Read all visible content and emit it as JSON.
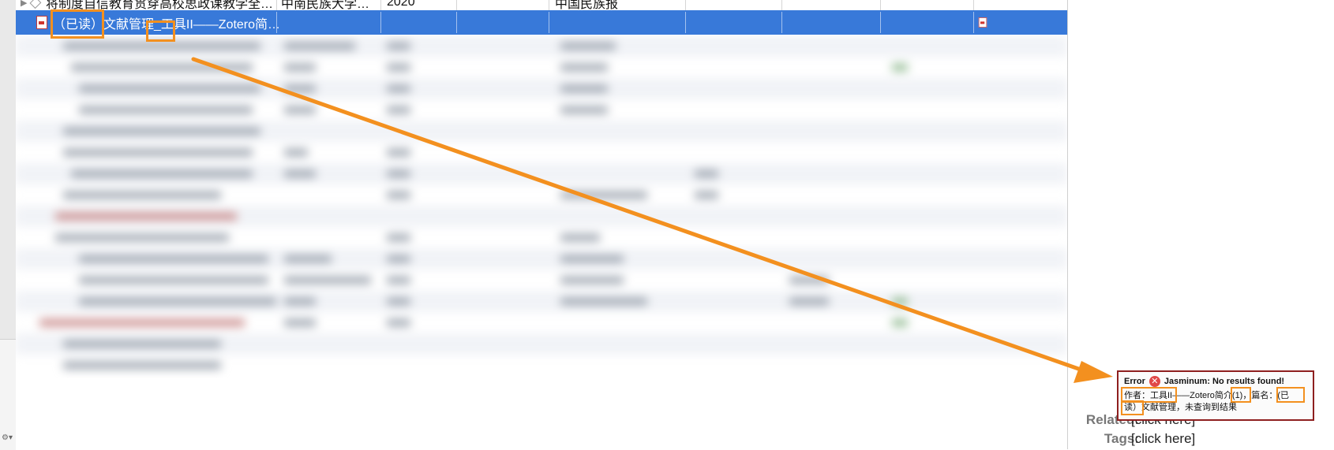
{
  "rows": {
    "previous": {
      "title": "将制度自信教育贯穿高校思政课教学全…",
      "creator": "中南民族大学…",
      "year": "2020",
      "publication": "中国民族报"
    },
    "selected": {
      "title": "（已读）文献管理_工具II——Zotero简…"
    }
  },
  "right_pane": {
    "related_label": "Related:",
    "related_value": "[click here]",
    "tags_label": "Tags:",
    "tags_value": "[click here]"
  },
  "popup": {
    "error_label": "Error",
    "message": "Jasminum: No results found!",
    "body_line1": "作者：工具II——Zotero简介(1)，篇名：(已",
    "body_line2": "读）文献管理，未查询到结果"
  },
  "colors": {
    "selection": "#3879d9",
    "annotation": "#f3901f",
    "popup_border": "#8e1f1f"
  }
}
